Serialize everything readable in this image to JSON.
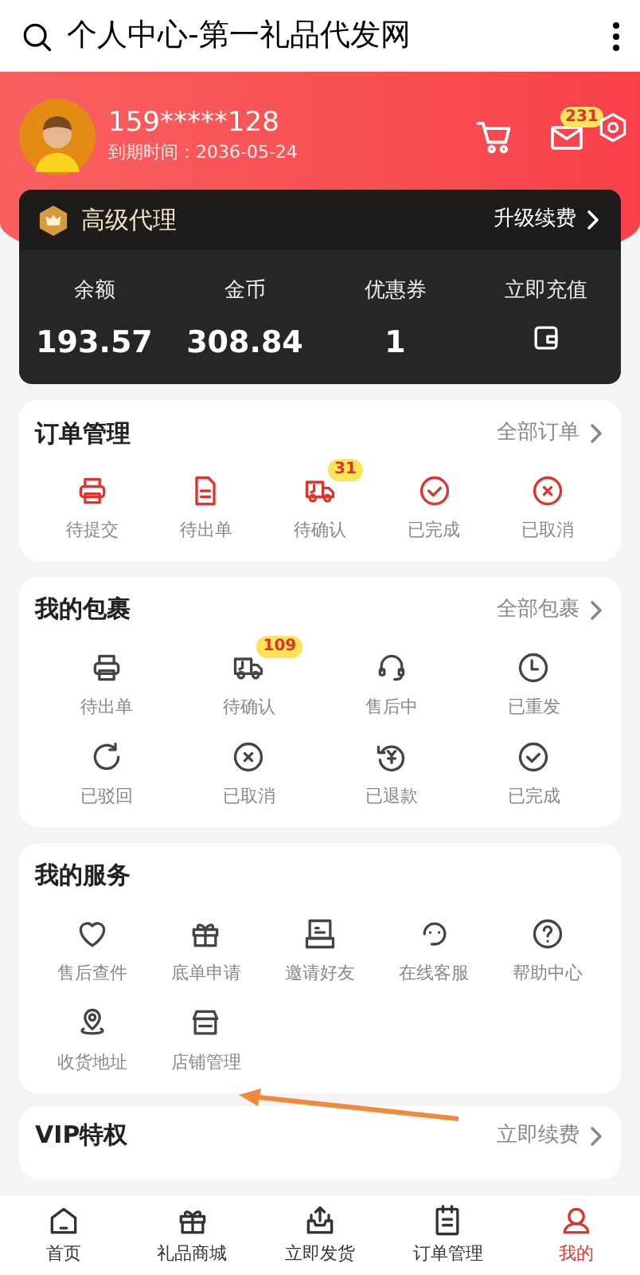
{
  "app_bar": {
    "title": "个人中心-第一礼品代发网"
  },
  "profile": {
    "phone": "159*****128",
    "expiry": "到期时间：2036-05-24",
    "message_badge": "231"
  },
  "member_card": {
    "level": "高级代理",
    "action": "升级续费",
    "stats": [
      {
        "label": "余额",
        "value": "193.57"
      },
      {
        "label": "金币",
        "value": "308.84"
      },
      {
        "label": "优惠券",
        "value": "1"
      },
      {
        "label": "立即充值"
      }
    ]
  },
  "sections": [
    {
      "title": "订单管理",
      "link": "全部订单",
      "accent": true,
      "items": [
        {
          "label": "待提交"
        },
        {
          "label": "待出单"
        },
        {
          "label": "待确认",
          "badge": "31"
        },
        {
          "label": "已完成"
        },
        {
          "label": "已取消"
        }
      ]
    },
    {
      "title": "我的包裹",
      "link": "全部包裹",
      "accent": false,
      "items": [
        {
          "label": "待出单"
        },
        {
          "label": "待确认",
          "badge": "109"
        },
        {
          "label": "售后中"
        },
        {
          "label": "已重发"
        },
        {
          "label": "已驳回"
        },
        {
          "label": "已取消"
        },
        {
          "label": "已退款"
        },
        {
          "label": "已完成"
        }
      ]
    },
    {
      "title": "我的服务",
      "accent": false,
      "items": [
        {
          "label": "售后查件"
        },
        {
          "label": "底单申请"
        },
        {
          "label": "邀请好友"
        },
        {
          "label": "在线客服"
        },
        {
          "label": "帮助中心"
        },
        {
          "label": "收货地址"
        },
        {
          "label": "店铺管理"
        }
      ]
    },
    {
      "title": "VIP特权",
      "link": "立即续费"
    }
  ],
  "bottom_nav": [
    {
      "label": "首页",
      "selected": false
    },
    {
      "label": "礼品商城",
      "selected": false
    },
    {
      "label": "立即发货",
      "selected": false
    },
    {
      "label": "订单管理",
      "selected": false
    },
    {
      "label": "我的",
      "selected": true
    }
  ]
}
